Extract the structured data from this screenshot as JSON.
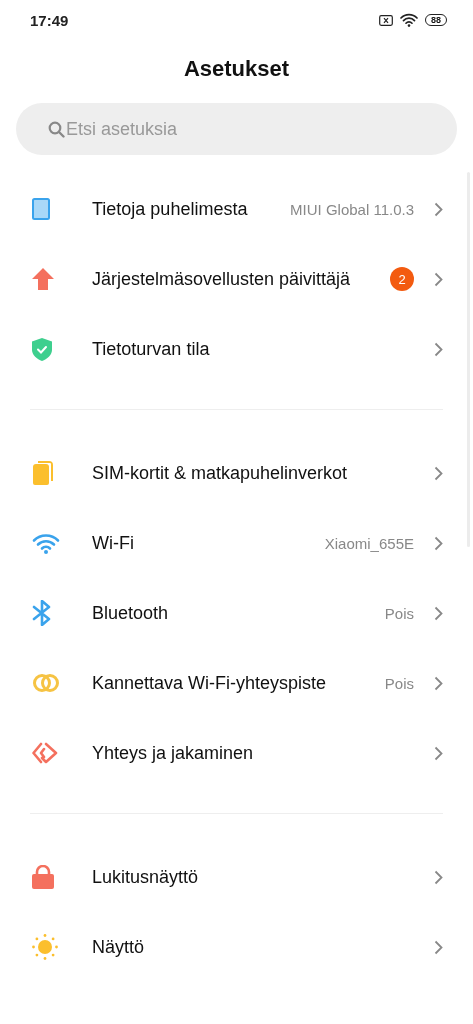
{
  "status_bar": {
    "time": "17:49",
    "battery": "88"
  },
  "title": "Asetukset",
  "search": {
    "placeholder": "Etsi asetuksia"
  },
  "groups": [
    {
      "items": [
        {
          "kind": "phone",
          "label": "Tietoja puhelimesta",
          "value": "MIUI Global 11.0.3"
        },
        {
          "kind": "update",
          "label": "Järjestelmäsovellusten päivittäjä",
          "badge": "2"
        },
        {
          "kind": "shield",
          "label": "Tietoturvan tila"
        }
      ]
    },
    {
      "items": [
        {
          "kind": "sim",
          "label": "SIM-kortit & matkapuhelinverkot"
        },
        {
          "kind": "wifi",
          "label": "Wi-Fi",
          "value": "Xiaomi_655E"
        },
        {
          "kind": "bluetooth",
          "label": "Bluetooth",
          "value": "Pois"
        },
        {
          "kind": "hotspot",
          "label": "Kannettava Wi-Fi-yhteyspiste",
          "value": "Pois"
        },
        {
          "kind": "share",
          "label": "Yhteys ja jakaminen"
        }
      ]
    },
    {
      "items": [
        {
          "kind": "lock",
          "label": "Lukitusnäyttö"
        },
        {
          "kind": "sun",
          "label": "Näyttö"
        }
      ]
    }
  ]
}
